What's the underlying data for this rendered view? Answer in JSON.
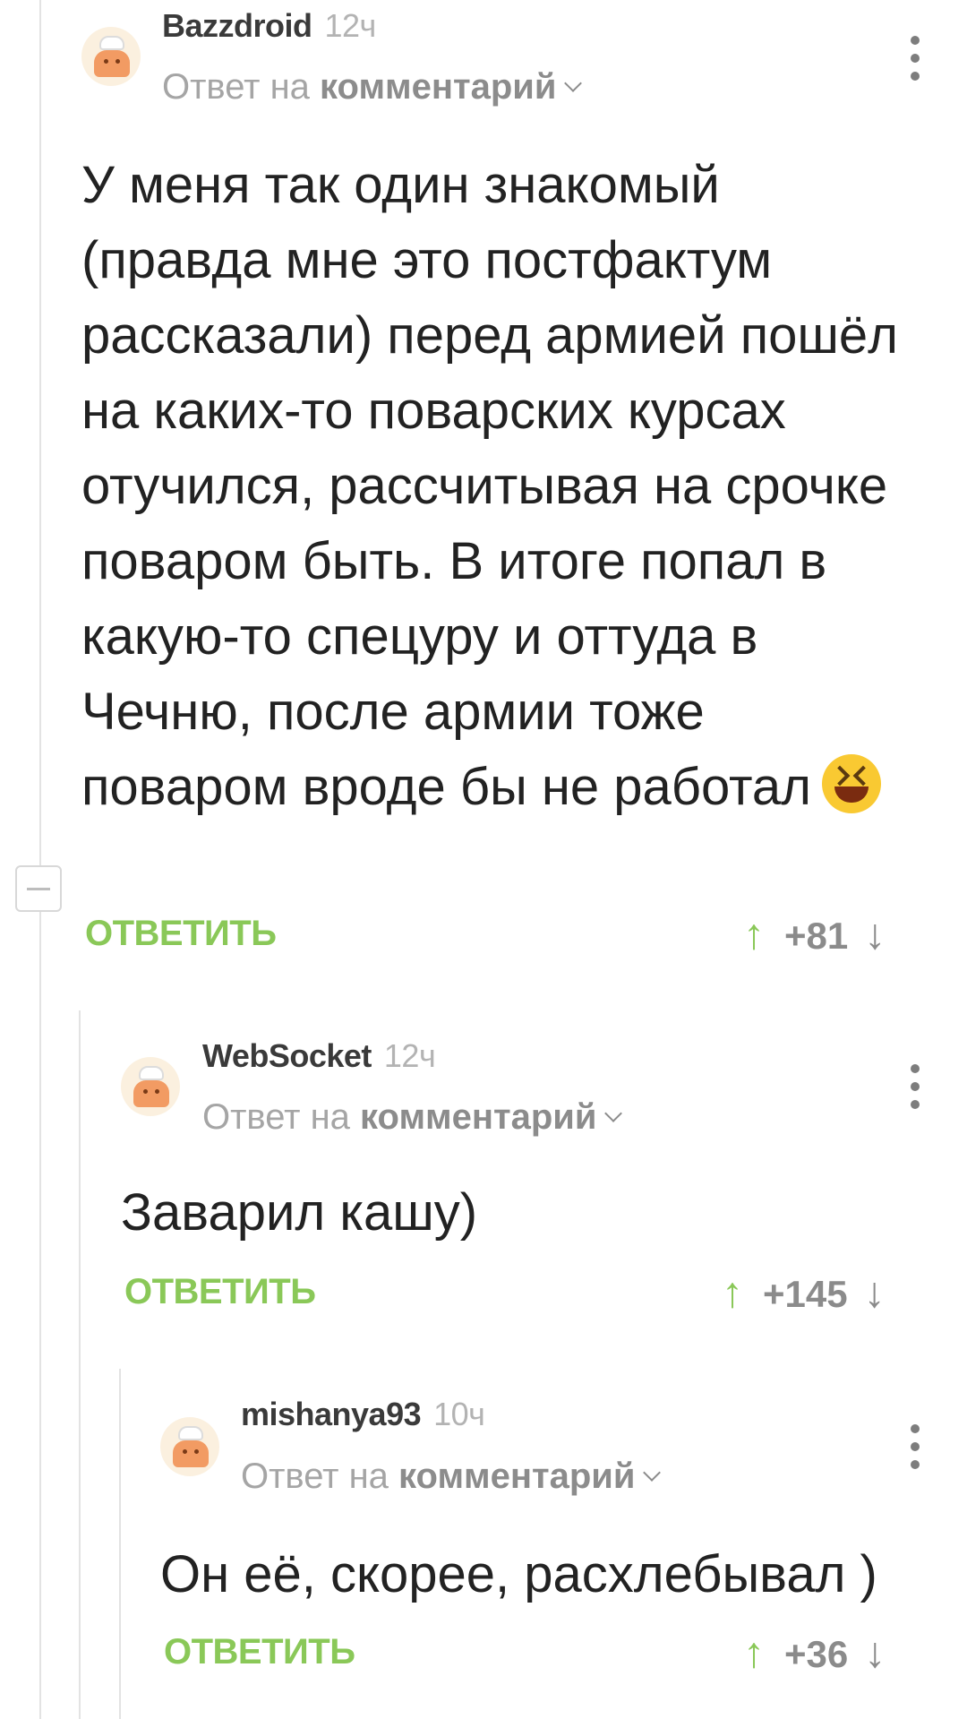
{
  "comments": [
    {
      "username": "Bazzdroid",
      "time": "12ч",
      "reply_prefix": "Ответ на",
      "reply_link": "комментарий",
      "text": "У меня так один знакомый (правда мне это постфактум рассказали) перед армией пошёл на каких-то поварских курсах отучился, рассчитывая на срочке поваром быть. В итоге попал в какую-то спецуру и оттуда в Чечню, после армии тоже поваром вроде бы не работал",
      "emoji": "laughing-face",
      "reply_label": "ОТВЕТИТЬ",
      "score": "+81"
    },
    {
      "username": "WebSocket",
      "time": "12ч",
      "reply_prefix": "Ответ на",
      "reply_link": "комментарий",
      "text": "Заварил кашу)",
      "reply_label": "ОТВЕТИТЬ",
      "score": "+145"
    },
    {
      "username": "mishanya93",
      "time": "10ч",
      "reply_prefix": "Ответ на",
      "reply_link": "комментарий",
      "text": "Он её, скорее, расхлебывал )",
      "reply_label": "ОТВЕТИТЬ",
      "score": "+36"
    }
  ],
  "icons": {
    "upvote": "↑",
    "downvote": "↓"
  },
  "colors": {
    "accent_green": "#8ac858",
    "text": "#222222",
    "muted": "#a5a5a5"
  }
}
